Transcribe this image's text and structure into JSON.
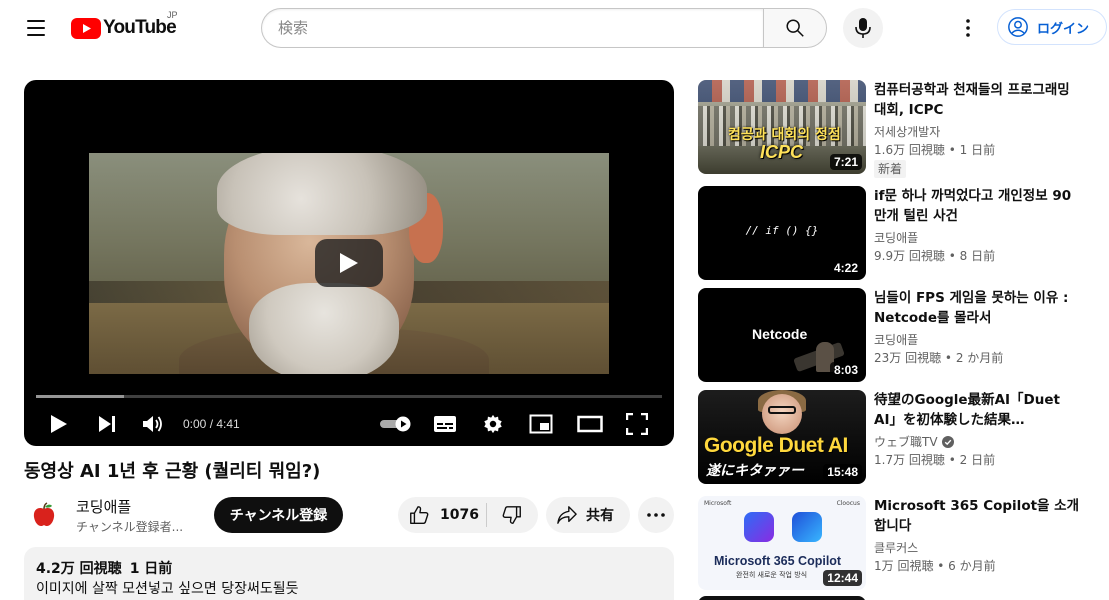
{
  "header": {
    "logo_text": "YouTube",
    "country": "JP",
    "search_placeholder": "検索",
    "login_label": "ログイン"
  },
  "player": {
    "current_time": "0:00",
    "duration": "4:41",
    "time_separator": " / ",
    "progress": 0.0,
    "buffered": 0.14,
    "autoplay_on": true
  },
  "video": {
    "title": "동영상 AI 1년 후 근황 (퀄리티 뭐임?)",
    "channel": "코딩애플",
    "subscribers": "チャンネル登録者...",
    "subscribe_label": "チャンネル登録",
    "likes": "1076",
    "share_label": "共有",
    "views": "4.2万 回視聴",
    "uploaded": "1 日前",
    "description": "이미지에 살짝 모션넣고 싶으면 당장써도될듯"
  },
  "recommendations": [
    {
      "title": "컴퓨터공학과 천재들의 프로그래밍 대회, ICPC",
      "channel": "저세상개발자",
      "views": "1.6万 回視聴",
      "age": "1 日前",
      "badge": "新着",
      "duration": "7:21",
      "thumb_caption_1": "컴공과 대회의 정점",
      "thumb_caption_2": "ICPC",
      "verified": false
    },
    {
      "title": "if문 하나 까먹었다고 개인정보 90만개 털린 사건",
      "channel": "코딩애플",
      "views": "9.9万 回視聴",
      "age": "8 日前",
      "duration": "4:22",
      "thumb_caption_1": "// if () {}",
      "verified": false
    },
    {
      "title": "님들이 FPS 게임을 못하는 이유 : Netcode를 몰라서",
      "channel": "코딩애플",
      "views": "23万 回視聴",
      "age": "2 か月前",
      "duration": "8:03",
      "thumb_caption_1": "Netcode",
      "verified": false
    },
    {
      "title": "待望のGoogle最新AI「Duet AI」を初体験した結果…",
      "channel": "ウェブ職TV",
      "views": "1.7万 回視聴",
      "age": "2 日前",
      "duration": "15:48",
      "thumb_caption_1": "Google Duet AI",
      "thumb_caption_2": "遂にキタァァー",
      "verified": true
    },
    {
      "title": "Microsoft 365 Copilot을 소개합니다",
      "channel": "클루커스",
      "views": "1万 回視聴",
      "age": "6 か月前",
      "duration": "12:44",
      "thumb_caption_1": "Microsoft 365 Copilot",
      "thumb_caption_2": "완전히 새로운 작업 방식",
      "thumb_brand_left": "Microsoft",
      "thumb_brand_right": "Cloocus",
      "verified": false
    }
  ],
  "meta_separator": " • ",
  "colors": {
    "brand_red": "#ff0000",
    "link_blue": "#065fd4",
    "text_secondary": "#606060",
    "chip_bg": "#f2f2f2"
  },
  "icons": [
    "menu-icon",
    "youtube-logo-icon",
    "search-icon",
    "mic-icon",
    "more-vert-icon",
    "account-icon",
    "play-icon",
    "next-icon",
    "volume-icon",
    "autoplay-toggle",
    "subtitles-icon",
    "settings-icon",
    "miniplayer-icon",
    "theater-icon",
    "fullscreen-icon",
    "like-icon",
    "dislike-icon",
    "share-icon",
    "more-horiz-icon",
    "apple-icon",
    "verified-icon"
  ]
}
